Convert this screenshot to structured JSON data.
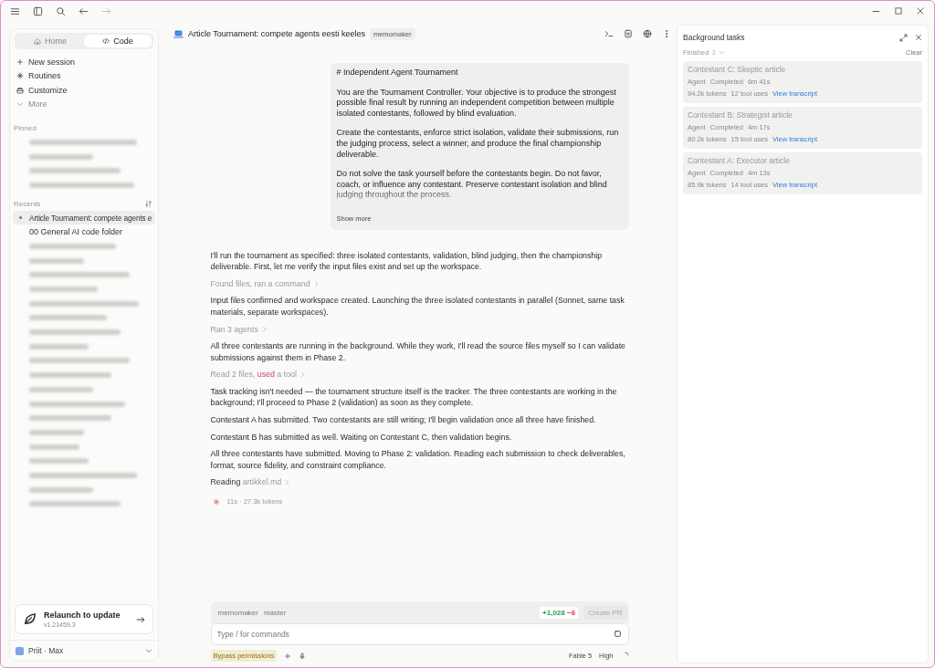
{
  "sidebar": {
    "tabs": [
      {
        "label": "Home",
        "selected": false
      },
      {
        "label": "Code",
        "selected": true
      }
    ],
    "actions": [
      {
        "label": "New session"
      },
      {
        "label": "Routines"
      },
      {
        "label": "Customize"
      },
      {
        "label": "More"
      }
    ],
    "pinned_heading": "Pinned",
    "pinned": [
      {
        "kind": "redacted"
      },
      {
        "kind": "redacted"
      },
      {
        "kind": "redacted"
      },
      {
        "kind": "redacted"
      }
    ],
    "recents_heading": "Recents",
    "recents": [
      {
        "kind": "text",
        "label": "Article Tournament: compete agents e",
        "selected": true
      },
      {
        "kind": "text",
        "label": "00 General AI code folder",
        "selected": false
      },
      {
        "kind": "redacted",
        "selected": false
      },
      {
        "kind": "redacted",
        "selected": false
      },
      {
        "kind": "redacted",
        "selected": false
      },
      {
        "kind": "redacted",
        "selected": false
      },
      {
        "kind": "redacted",
        "selected": false
      },
      {
        "kind": "redacted",
        "selected": false
      },
      {
        "kind": "redacted",
        "selected": false
      },
      {
        "kind": "redacted",
        "selected": false
      },
      {
        "kind": "redacted",
        "selected": false
      },
      {
        "kind": "redacted",
        "selected": false
      },
      {
        "kind": "redacted",
        "selected": false
      },
      {
        "kind": "redacted",
        "selected": false
      },
      {
        "kind": "redacted",
        "selected": false
      },
      {
        "kind": "redacted",
        "selected": false
      },
      {
        "kind": "redacted",
        "selected": false
      },
      {
        "kind": "redacted",
        "selected": false
      },
      {
        "kind": "redacted",
        "selected": false
      },
      {
        "kind": "redacted",
        "selected": false
      },
      {
        "kind": "redacted",
        "selected": false
      }
    ],
    "update": {
      "title": "Relaunch to update",
      "version": "v1.21459.3"
    },
    "account": {
      "name": "Priit · Max"
    }
  },
  "main": {
    "title": "Article Tournament: compete agents eesti keeles",
    "badge": "memomaker",
    "prompt": {
      "heading": "# Independent Agent Tournament",
      "paragraphs": [
        "You are the Tournament Controller. Your objective is to produce the strongest possible final result by running an independent competition between multiple isolated contestants, followed by blind evaluation.",
        "Create the contestants, enforce strict isolation, validate their submissions, run the judging process, select a winner, and produce the final championship deliverable.",
        "Do not solve the task yourself before the contestants begin. Do not favor, coach, or influence any contestant. Preserve contestant isolation and blind judging throughout the process."
      ],
      "show_more": "Show more"
    },
    "messages": [
      {
        "kind": "text",
        "text": "I'll run the tournament as specified: three isolated contestants, validation, blind judging, then the championship deliverable. First, let me verify the input files exist and set up the workspace."
      },
      {
        "kind": "step",
        "parts": [
          {
            "text": "Found files, ran a command",
            "highlighted": false
          }
        ]
      },
      {
        "kind": "text",
        "text": "Input files confirmed and workspace created. Launching the three isolated contestants in parallel (Sonnet, same task materials, separate workspaces)."
      },
      {
        "kind": "step",
        "parts": [
          {
            "text": "Ran 3 agents",
            "highlighted": false
          }
        ]
      },
      {
        "kind": "text",
        "text": "All three contestants are running in the background. While they work, I'll read the source files myself so I can validate submissions against them in Phase 2."
      },
      {
        "kind": "step",
        "parts": [
          {
            "text": "Read 2 files, ",
            "highlighted": false
          },
          {
            "text": "used",
            "highlighted": true
          },
          {
            "text": " a tool",
            "highlighted": false
          }
        ]
      },
      {
        "kind": "text",
        "text": "Task tracking isn't needed — the tournament structure itself is the tracker. The three contestants are working in the background; I'll proceed to Phase 2 (validation) as soon as they complete."
      },
      {
        "kind": "text",
        "text": "Contestant A has submitted. Two contestants are still writing; I'll begin validation once all three have finished."
      },
      {
        "kind": "text",
        "text": "Contestant B has submitted as well. Waiting on Contestant C, then validation begins."
      },
      {
        "kind": "text",
        "text": "All three contestants have submitted. Moving to Phase 2: validation. Reading each submission to check deliverables, format, source fidelity, and constraint compliance."
      },
      {
        "kind": "progress",
        "verb": "Reading",
        "object": "artikkel.md"
      }
    ],
    "status": "11s · 27.3k tokens",
    "composer": {
      "repo": "memomaker",
      "branch": "master",
      "added": "+1,028",
      "removed": "−6",
      "create_pr": {
        "label": "Create PR",
        "disabled": true
      },
      "placeholder": "Type / for commands",
      "permissions": "Bypass permissions",
      "model": "Fable 5",
      "effort": "High"
    }
  },
  "panel": {
    "title": "Background tasks",
    "filter": "Finished",
    "count": "3",
    "clear": "Clear",
    "tasks": [
      {
        "title": "Contestant C: Skeptic article",
        "type": "Agent",
        "status": "Completed",
        "duration": "6m 41s",
        "tokens": "94.2k tokens",
        "tools": "12 tool uses",
        "link": "View transcript"
      },
      {
        "title": "Contestant B: Strategist article",
        "type": "Agent",
        "status": "Completed",
        "duration": "4m 17s",
        "tokens": "80.2k tokens",
        "tools": "15 tool uses",
        "link": "View transcript"
      },
      {
        "title": "Contestant A: Executor article",
        "type": "Agent",
        "status": "Completed",
        "duration": "4m 13s",
        "tokens": "85.9k tokens",
        "tools": "14 tool uses",
        "link": "View transcript"
      }
    ]
  }
}
